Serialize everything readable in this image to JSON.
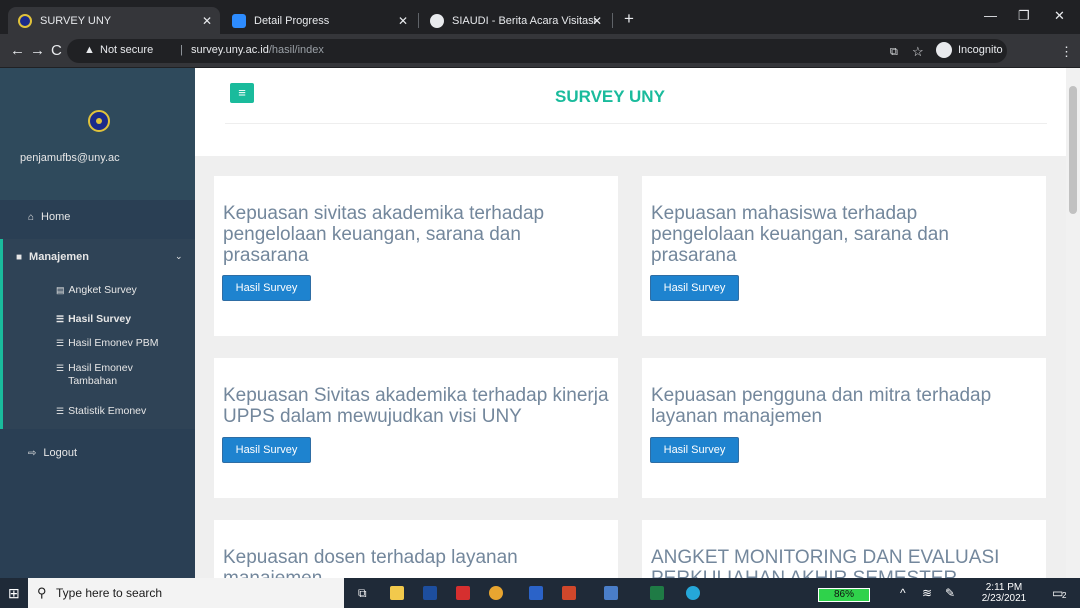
{
  "browser": {
    "tabs": [
      {
        "label": "SURVEY UNY"
      },
      {
        "label": "Detail Progress"
      },
      {
        "label": "SIAUDI - Berita Acara Visitasi"
      }
    ],
    "not_secure": "Not secure",
    "url_host": "survey.uny.ac.id",
    "url_path": "/hasil/index",
    "incognito": "Incognito"
  },
  "sidebar": {
    "email": "penjamufbs@uny.ac",
    "home": "Home",
    "manajemen": "Manajemen",
    "sub": [
      "Angket Survey",
      "Hasil Survey",
      "Hasil Emonev PBM",
      "Hasil Emonev Tambahan",
      "Statistik Emonev"
    ],
    "logout": "Logout"
  },
  "header": {
    "title": "SURVEY UNY"
  },
  "cards": [
    {
      "title": "Kepuasan sivitas akademika terhadap pengelolaan keuangan, sarana dan prasarana",
      "button": "Hasil Survey"
    },
    {
      "title": "Kepuasan mahasiswa terhadap pengelolaan keuangan, sarana dan prasarana",
      "button": "Hasil Survey"
    },
    {
      "title": "Kepuasan Sivitas akademika terhadap kinerja UPPS dalam mewujudkan visi UNY",
      "button": "Hasil Survey"
    },
    {
      "title": "Kepuasan pengguna dan mitra terhadap layanan manajemen",
      "button": "Hasil Survey"
    },
    {
      "title": "Kepuasan dosen terhadap layanan manajemen"
    },
    {
      "title": "ANGKET MONITORING DAN EVALUASI PERKULIAHAN AKHIR SEMESTER"
    }
  ],
  "taskbar": {
    "search_placeholder": "Type here to search",
    "battery": "86%",
    "time": "2:11 PM",
    "date": "2/23/2021",
    "notifications": "2"
  },
  "colors": {
    "accent": "#1abb9c",
    "button": "#1e83cf",
    "sidebar": "#2a3f54"
  }
}
